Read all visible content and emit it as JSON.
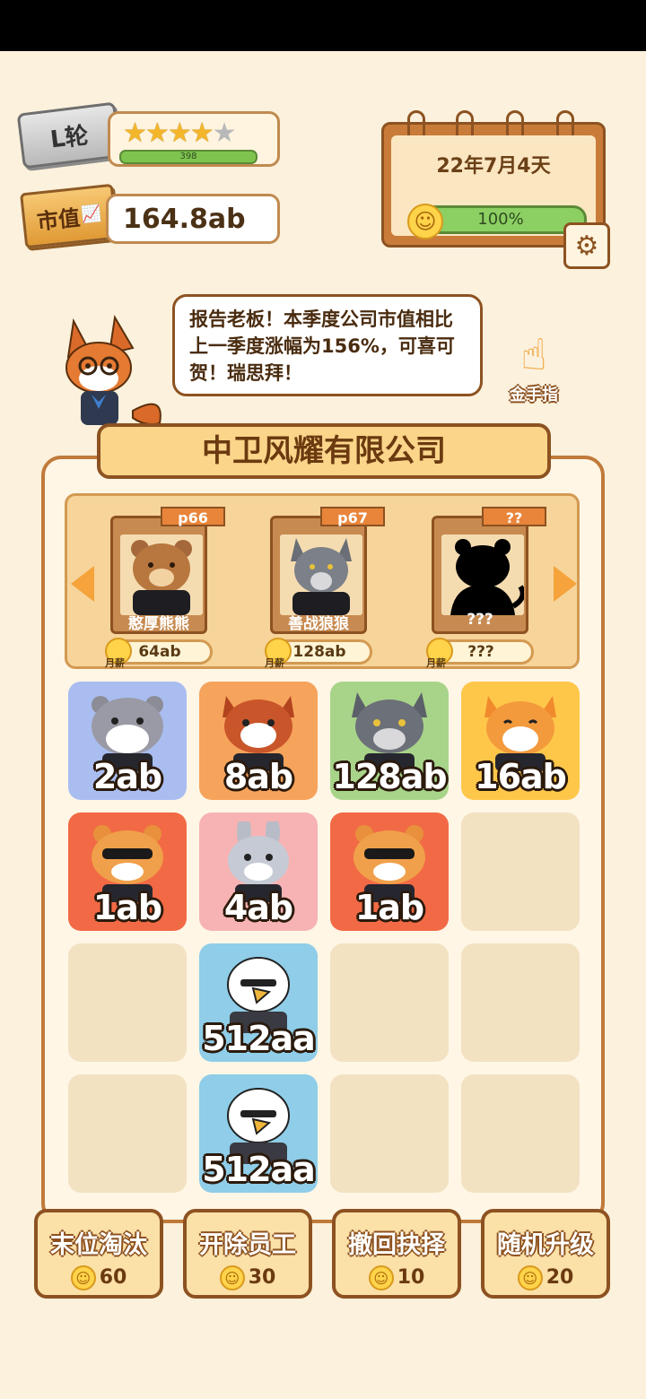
{
  "header": {
    "round_label": "L轮",
    "stars_filled": 4,
    "stars_total": 5,
    "xp_value": "398",
    "market_value_label": "市值",
    "market_value": "164.8ab"
  },
  "calendar": {
    "date": "22年7月4天",
    "mood_percent": "100%"
  },
  "speech": {
    "text": "报告老板！本季度公司市值相比上一季度涨幅为156%，可喜可贺！瑞思拜！"
  },
  "golden_finger_label": "金手指",
  "company_name": "中卫风耀有限公司",
  "recruit_cards": [
    {
      "level": "p66",
      "name": "憨厚熊熊",
      "price": "64ab",
      "monthly": "月薪"
    },
    {
      "level": "p67",
      "name": "善战狼狼",
      "price": "128ab",
      "monthly": "月薪"
    },
    {
      "level": "??",
      "name": "???",
      "price": "???",
      "monthly": "月薪"
    }
  ],
  "grid": [
    {
      "label": "2ab"
    },
    {
      "label": "8ab"
    },
    {
      "label": "128ab"
    },
    {
      "label": "16ab"
    },
    {
      "label": "1ab"
    },
    {
      "label": "4ab"
    },
    {
      "label": "1ab"
    },
    {
      "label": ""
    },
    {
      "label": ""
    },
    {
      "label": "512aa"
    },
    {
      "label": ""
    },
    {
      "label": ""
    },
    {
      "label": ""
    },
    {
      "label": "512aa"
    },
    {
      "label": ""
    },
    {
      "label": ""
    }
  ],
  "actions": [
    {
      "label": "末位淘汰",
      "cost": "60"
    },
    {
      "label": "开除员工",
      "cost": "30"
    },
    {
      "label": "撤回抉择",
      "cost": "10"
    },
    {
      "label": "随机升级",
      "cost": "20"
    }
  ],
  "colors": {
    "background": "#fbf1dc",
    "accent_brown": "#8d5221",
    "mood_green": "#8ccf63"
  }
}
